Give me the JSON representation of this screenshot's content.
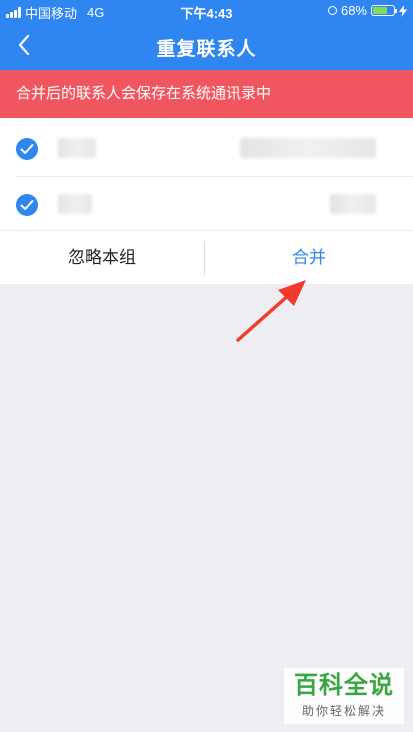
{
  "status_bar": {
    "carrier": "中国移动",
    "network": "4G",
    "time": "下午4:43",
    "battery_percent": "68%",
    "battery_level": 0.68
  },
  "nav": {
    "back_icon": "chevron-left-icon",
    "title": "重复联系人"
  },
  "banner": {
    "text": "合并后的联系人会保存在系统通讯录中",
    "color": "#f0565f"
  },
  "contacts": [
    {
      "checked": true,
      "icon": "check-circle-icon"
    },
    {
      "checked": true,
      "icon": "check-circle-icon"
    }
  ],
  "actions": {
    "ignore_label": "忽略本组",
    "merge_label": "合并"
  },
  "watermark": {
    "title": "百科全说",
    "subtitle": "助你轻松解决"
  },
  "colors": {
    "primary": "#2f86f0",
    "background": "#eeeef2",
    "alert": "#f0565f",
    "annotation_arrow": "#f23a2e"
  }
}
